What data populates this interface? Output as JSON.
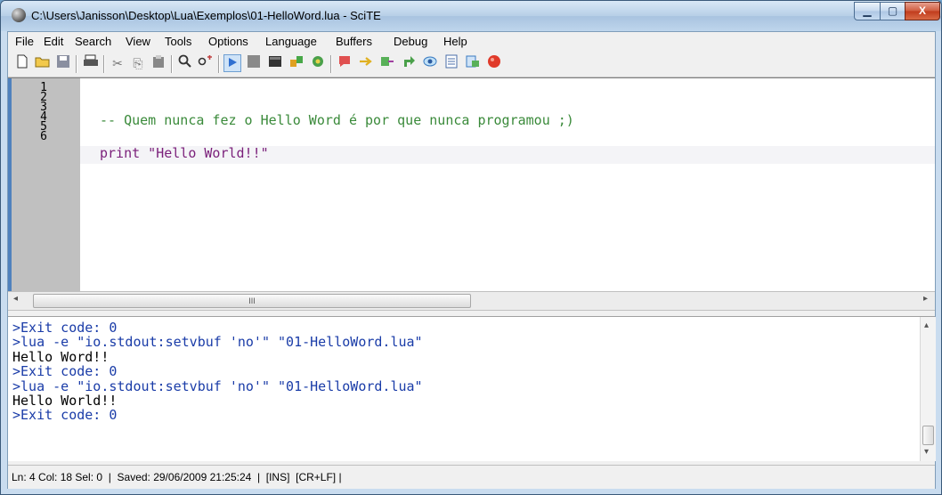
{
  "window": {
    "title": "C:\\Users\\Janisson\\Desktop\\Lua\\Exemplos\\01-HelloWord.lua - SciTE",
    "min_glyph": "▁",
    "max_glyph": "▢",
    "close_glyph": "X"
  },
  "menu": [
    "File",
    "Edit",
    "Search",
    "View",
    "Tools",
    "Options",
    "Language",
    "Buffers",
    "Debug",
    "Help"
  ],
  "toolbar": {
    "icons": [
      "new-icon",
      "open-icon",
      "save-icon",
      "print-icon",
      "cut-icon",
      "copy-icon",
      "paste-icon",
      "find-icon",
      "replace-icon",
      "go-icon",
      "stop-icon",
      "console-icon",
      "build-icon",
      "compile-icon",
      "bookmark-icon",
      "next-icon",
      "prev-icon",
      "jump-icon",
      "watch-icon",
      "list-icon",
      "export-icon",
      "record-icon"
    ]
  },
  "editor": {
    "line_numbers": [
      "1",
      "2",
      "3",
      "4",
      "5",
      "6"
    ],
    "lines": [
      {
        "line": 2,
        "text": "-- Quem nunca fez o Hello Word é por que nunca programou ;)",
        "color": "#3a8a3a"
      },
      {
        "line": 4,
        "text": "print \"Hello World!!\"",
        "color": "#7a1f7a"
      }
    ],
    "hscroll_label": "III"
  },
  "output": {
    "lines": [
      {
        "text": ">Exit code: 0",
        "color": "#1a3ca8"
      },
      {
        "text": ">lua -e \"io.stdout:setvbuf 'no'\" \"01-HelloWord.lua\"",
        "color": "#1a3ca8"
      },
      {
        "text": "Hello Word!!",
        "color": "#000000"
      },
      {
        "text": ">Exit code: 0",
        "color": "#1a3ca8"
      },
      {
        "text": ">lua -e \"io.stdout:setvbuf 'no'\" \"01-HelloWord.lua\"",
        "color": "#1a3ca8"
      },
      {
        "text": "Hello World!!",
        "color": "#000000"
      },
      {
        "text": ">Exit code: 0",
        "color": "#1a3ca8"
      }
    ]
  },
  "status": {
    "text": "Ln: 4 Col: 18 Sel: 0  |  Saved: 29/06/2009 21:25:24  |  [INS]  [CR+LF] |"
  }
}
